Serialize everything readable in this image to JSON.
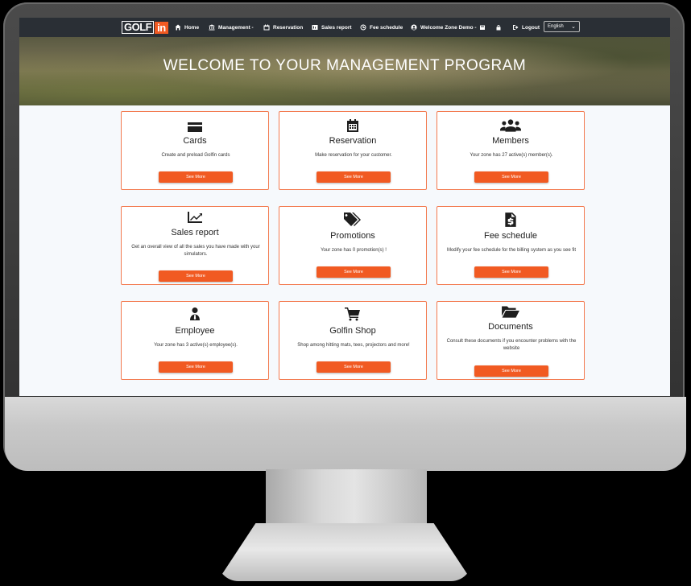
{
  "brand": {
    "logo_left": "GOLF",
    "logo_right": "in"
  },
  "nav": {
    "home": "Home",
    "management": "Management -",
    "reservation": "Reservation",
    "sales_report": "Sales report",
    "fee_schedule": "Fee schedule",
    "welcome": "Welcome Zone Demo -",
    "logout": "Logout",
    "language": "English"
  },
  "hero": {
    "title": "WELCOME TO YOUR MANAGEMENT PROGRAM"
  },
  "cards": [
    {
      "title": "Cards",
      "desc": "Create and preload Golfin cards",
      "button": "See More",
      "icon": "credit-card-icon"
    },
    {
      "title": "Reservation",
      "desc": "Make reservation for your customer.",
      "button": "See More",
      "icon": "calendar-icon"
    },
    {
      "title": "Members",
      "desc": "Your zone has 27 active(s) member(s).",
      "button": "See More",
      "icon": "users-icon"
    },
    {
      "title": "Sales report",
      "desc": "Get an overall view of all the sales you have made with your simulators.",
      "button": "See More",
      "icon": "chart-line-icon"
    },
    {
      "title": "Promotions",
      "desc": "Your zone has 0 promotion(s) !",
      "button": "See More",
      "icon": "tags-icon"
    },
    {
      "title": "Fee schedule",
      "desc": "Modify your fee schedule for the billing system as you see fit",
      "button": "See More",
      "icon": "invoice-dollar-icon"
    },
    {
      "title": "Employee",
      "desc": "Your zone has 3 active(s) employee(s).",
      "button": "See More",
      "icon": "employee-icon"
    },
    {
      "title": "Golfin Shop",
      "desc": "Shop among hitting mats, tees, projectors and more!",
      "button": "See More",
      "icon": "shopping-cart-icon"
    },
    {
      "title": "Documents",
      "desc": "Consult these documents if you encounter problems with the website",
      "button": "See More",
      "icon": "folder-open-icon"
    }
  ],
  "colors": {
    "accent": "#f15a22",
    "navbar": "#2a2f35",
    "card_border": "#f37a4f"
  }
}
